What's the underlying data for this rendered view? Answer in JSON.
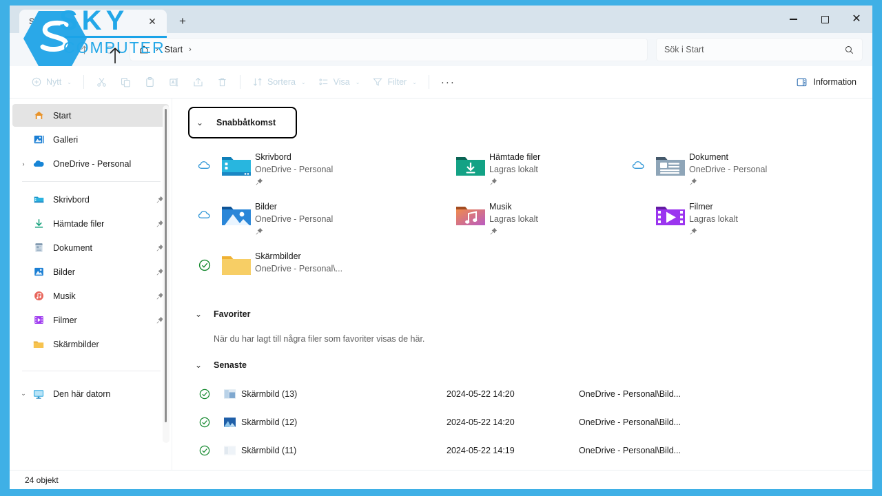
{
  "window": {
    "frame_color": "#3fb0e6",
    "titlebar_color": "#d7e3ec",
    "tab_label": "Start",
    "close_tab_glyph": "✕",
    "new_tab_glyph": "+",
    "minimize_label": "Minimera",
    "maximize_label": "Maximera",
    "close_label": "Stäng"
  },
  "watermark": {
    "line1": "SKY",
    "line2": "COMPUTER",
    "color": "#22a7e8"
  },
  "nav": {
    "back_label": "Tillbaka",
    "forward_label": "Framåt",
    "up_label": "Upp",
    "refresh_label": "Uppdatera",
    "breadcrumb": [
      "Start"
    ],
    "separator": "›"
  },
  "search": {
    "placeholder": "Sök i Start",
    "value": ""
  },
  "ribbon": {
    "new_label": "Nytt",
    "cut_label": "Klipp ut",
    "copy_label": "Kopiera",
    "paste_label": "Klistra in",
    "rename_label": "Byt namn",
    "share_label": "Dela",
    "delete_label": "Ta bort",
    "sort_label": "Sortera",
    "view_label": "Visa",
    "filter_label": "Filter",
    "more_label": "···",
    "info_label": "Information",
    "caret": "⌄"
  },
  "sidebar": {
    "items": [
      {
        "label": "Start",
        "icon": "home-icon",
        "selected": true,
        "pinned": false,
        "chevron": ""
      },
      {
        "label": "Galleri",
        "icon": "gallery-icon",
        "selected": false,
        "pinned": false,
        "chevron": ""
      },
      {
        "label": "OneDrive - Personal",
        "icon": "onedrive-icon",
        "selected": false,
        "pinned": false,
        "chevron": "›"
      }
    ],
    "pinned_items": [
      {
        "label": "Skrivbord",
        "icon": "desktop-folder-icon",
        "pinned": true
      },
      {
        "label": "Hämtade filer",
        "icon": "downloads-icon",
        "pinned": true
      },
      {
        "label": "Dokument",
        "icon": "documents-icon",
        "pinned": true
      },
      {
        "label": "Bilder",
        "icon": "pictures-icon",
        "pinned": true
      },
      {
        "label": "Musik",
        "icon": "music-icon",
        "pinned": true
      },
      {
        "label": "Filmer",
        "icon": "videos-icon",
        "pinned": true
      },
      {
        "label": "Skärmbilder",
        "icon": "folder-icon",
        "pinned": false
      }
    ],
    "bottom_items": [
      {
        "label": "Den här datorn",
        "icon": "this-pc-icon",
        "chevron": "⌄"
      }
    ]
  },
  "main": {
    "quick_access": {
      "title": "Snabbåtkomst",
      "chevron": "⌄",
      "highlighted": true,
      "items": [
        {
          "name": "Skrivbord",
          "sub": "OneDrive - Personal",
          "icon": "desktop-folder-icon",
          "status": "cloud-icon",
          "pinned": true
        },
        {
          "name": "Hämtade filer",
          "sub": "Lagras lokalt",
          "icon": "downloads-folder-icon",
          "status": "none",
          "pinned": true
        },
        {
          "name": "Dokument",
          "sub": "OneDrive - Personal",
          "icon": "documents-folder-icon",
          "status": "cloud-icon",
          "pinned": true
        },
        {
          "name": "Bilder",
          "sub": "OneDrive - Personal",
          "icon": "pictures-folder-icon",
          "status": "cloud-icon",
          "pinned": true
        },
        {
          "name": "Musik",
          "sub": "Lagras lokalt",
          "icon": "music-folder-icon",
          "status": "none",
          "pinned": true
        },
        {
          "name": "Filmer",
          "sub": "Lagras lokalt",
          "icon": "videos-folder-icon",
          "status": "none",
          "pinned": true
        },
        {
          "name": "Skärmbilder",
          "sub": "OneDrive - Personal\\...",
          "icon": "plain-folder-icon",
          "status": "synced-icon",
          "pinned": false
        }
      ]
    },
    "favorites": {
      "title": "Favoriter",
      "chevron": "⌄",
      "empty_text": "När du har lagt till några filer som favoriter visas de här."
    },
    "recent": {
      "title": "Senaste",
      "chevron": "⌄",
      "rows": [
        {
          "status": "synced-icon",
          "icon": "image-thumb-1",
          "name": "Skärmbild (13)",
          "date": "2024-05-22 14:20",
          "path": "OneDrive - Personal\\Bild..."
        },
        {
          "status": "synced-icon",
          "icon": "image-thumb-2",
          "name": "Skärmbild (12)",
          "date": "2024-05-22 14:20",
          "path": "OneDrive - Personal\\Bild..."
        },
        {
          "status": "synced-icon",
          "icon": "image-thumb-3",
          "name": "Skärmbild (11)",
          "date": "2024-05-22 14:19",
          "path": "OneDrive - Personal\\Bild..."
        }
      ]
    }
  },
  "statusbar": {
    "item_count": "24 objekt"
  }
}
